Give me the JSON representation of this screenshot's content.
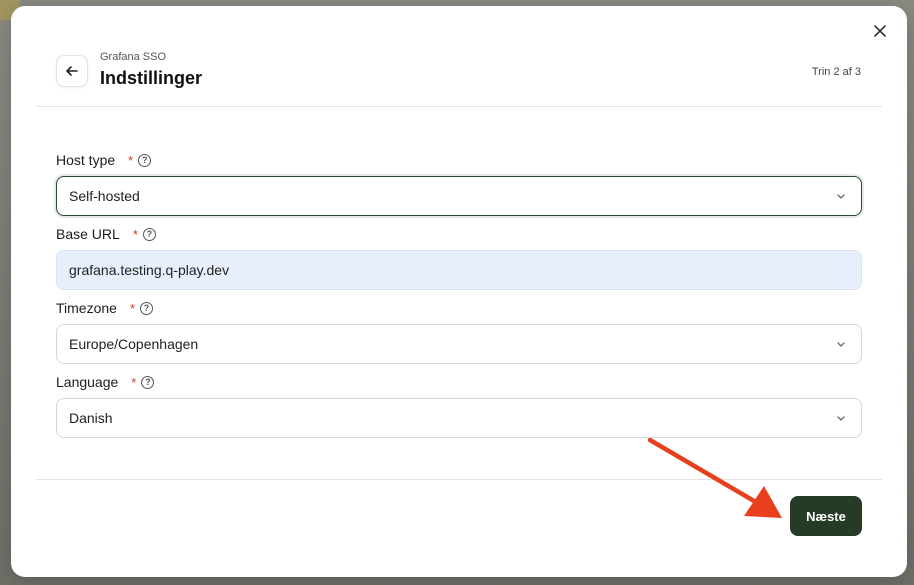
{
  "modal": {
    "eyebrow": "Grafana SSO",
    "title": "Indstillinger",
    "step": "Trin 2 af 3"
  },
  "form": {
    "fields": [
      {
        "label": "Host type",
        "required": "*",
        "value": "Self-hosted",
        "kind": "select"
      },
      {
        "label": "Base URL",
        "required": "*",
        "value": "grafana.testing.q-play.dev",
        "kind": "text"
      },
      {
        "label": "Timezone",
        "required": "*",
        "value": "Europe/Copenhagen",
        "kind": "select"
      },
      {
        "label": "Language",
        "required": "*",
        "value": "Danish",
        "kind": "select"
      }
    ]
  },
  "footer": {
    "next_label": "Næste"
  },
  "colors": {
    "accent": "#253b25",
    "required": "#d63a2a",
    "annotation": "#e8401f",
    "filled_input": "#e8effc"
  },
  "icons": [
    "close-icon",
    "back-arrow-icon",
    "help-icon",
    "chevron-down-icon"
  ]
}
